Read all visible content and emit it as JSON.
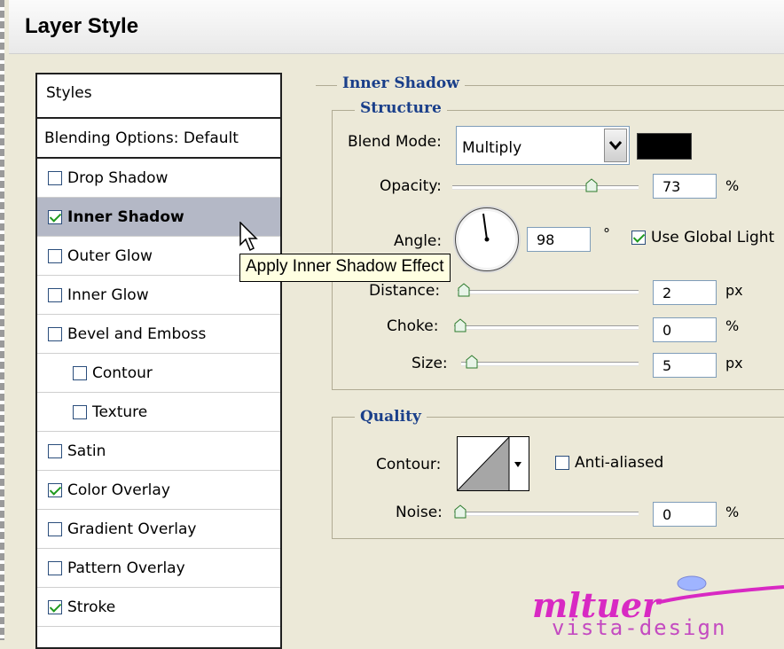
{
  "window": {
    "title": "Layer Style"
  },
  "styles_panel": {
    "header": "Styles",
    "blending_options": "Blending Options: Default",
    "items": [
      {
        "label": "Drop Shadow",
        "checked": false
      },
      {
        "label": "Inner Shadow",
        "checked": true,
        "selected": true
      },
      {
        "label": "Outer Glow",
        "checked": false
      },
      {
        "label": "Inner Glow",
        "checked": false
      },
      {
        "label": "Bevel and Emboss",
        "checked": false
      },
      {
        "label": "Contour",
        "checked": false,
        "indent": true
      },
      {
        "label": "Texture",
        "checked": false,
        "indent": true
      },
      {
        "label": "Satin",
        "checked": false
      },
      {
        "label": "Color Overlay",
        "checked": true
      },
      {
        "label": "Gradient Overlay",
        "checked": false
      },
      {
        "label": "Pattern Overlay",
        "checked": false
      },
      {
        "label": "Stroke",
        "checked": true
      }
    ]
  },
  "tooltip": "Apply Inner Shadow Effect",
  "inner_shadow": {
    "title": "Inner Shadow",
    "structure": {
      "title": "Structure",
      "blend_mode_label": "Blend Mode:",
      "blend_mode_value": "Multiply",
      "blend_color": "#000000",
      "opacity_label": "Opacity:",
      "opacity_value": "73",
      "opacity_unit": "%",
      "angle_label": "Angle:",
      "angle_value": "98",
      "angle_unit": "°",
      "use_global_light_label": "Use Global Light",
      "use_global_light_checked": true,
      "distance_label": "Distance:",
      "distance_value": "2",
      "distance_unit": "px",
      "choke_label": "Choke:",
      "choke_value": "0",
      "choke_unit": "%",
      "size_label": "Size:",
      "size_value": "5",
      "size_unit": "px"
    },
    "quality": {
      "title": "Quality",
      "contour_label": "Contour:",
      "anti_aliased_label": "Anti-aliased",
      "anti_aliased_checked": false,
      "noise_label": "Noise:",
      "noise_value": "0",
      "noise_unit": "%"
    }
  },
  "watermark": {
    "main": "mltuer",
    "sub": "vista-design"
  }
}
